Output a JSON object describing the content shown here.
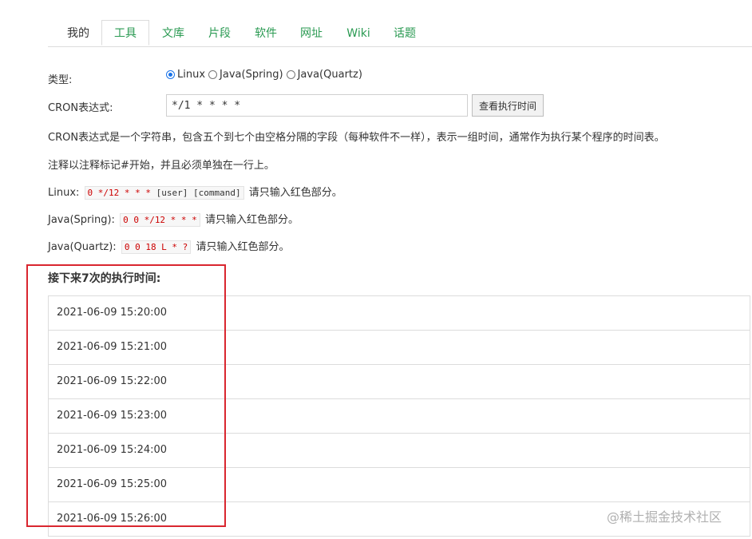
{
  "tabs": [
    {
      "label": "我的"
    },
    {
      "label": "工具"
    },
    {
      "label": "文库"
    },
    {
      "label": "片段"
    },
    {
      "label": "软件"
    },
    {
      "label": "网址"
    },
    {
      "label": "Wiki"
    },
    {
      "label": "话题"
    }
  ],
  "form": {
    "type_label": "类型:",
    "options": [
      "Linux",
      "Java(Spring)",
      "Java(Quartz)"
    ],
    "selected": "Linux",
    "cron_label": "CRON表达式:",
    "cron_value": "*/1 * * * *",
    "button_label": "查看执行时间"
  },
  "info": {
    "desc": "CRON表达式是一个字符串，包含五个到七个由空格分隔的字段（每种软件不一样），表示一组时间，通常作为执行某个程序的时间表。",
    "comment": "注释以注释标记#开始，并且必须单独在一行上。",
    "linux_label": "Linux:",
    "linux_code": "0 */12 * * *",
    "linux_code_tail": "[user] [command]",
    "spring_label": "Java(Spring):",
    "spring_code": "0 0 */12 * * *",
    "quartz_label": "Java(Quartz):",
    "quartz_code": "0 0 18 L * ?",
    "hint": "请只输入红色部分。"
  },
  "results": {
    "heading": "接下来7次的执行时间:",
    "items": [
      "2021-06-09 15:20:00",
      "2021-06-09 15:21:00",
      "2021-06-09 15:22:00",
      "2021-06-09 15:23:00",
      "2021-06-09 15:24:00",
      "2021-06-09 15:25:00",
      "2021-06-09 15:26:00"
    ]
  },
  "watermark": "@稀土掘金技术社区",
  "colors": {
    "accent": "#2a9a52",
    "highlight": "#d9262f",
    "code": "#cc0000",
    "radio": "#1a73e8"
  }
}
